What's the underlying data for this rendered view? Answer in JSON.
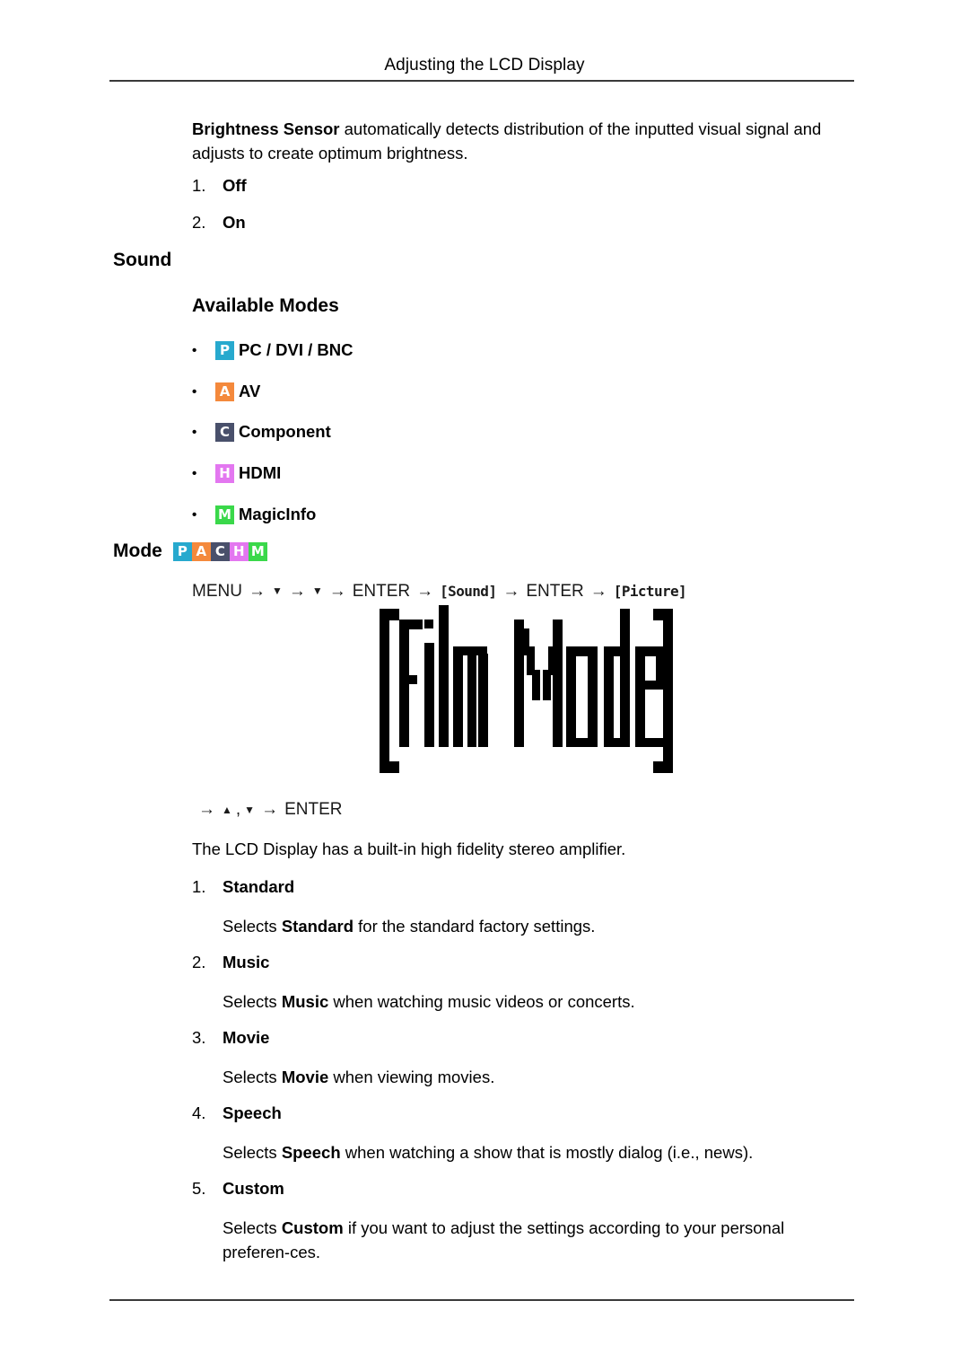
{
  "header": {
    "title": "Adjusting the LCD Display"
  },
  "intro": {
    "bold_lead": "Brightness Sensor",
    "rest": " automatically detects distribution of the inputted visual signal and adjusts to create optimum brightness."
  },
  "brightness_options": [
    {
      "num": "1.",
      "label": "Off"
    },
    {
      "num": "2.",
      "label": "On"
    }
  ],
  "sections": {
    "sound_heading": "Sound",
    "available_modes_heading": "Available Modes",
    "mode_heading": "Mode"
  },
  "available_modes": [
    {
      "bullet": "•",
      "badge": "P",
      "badge_color": "#27a9ce",
      "label": "PC / DVI / BNC"
    },
    {
      "bullet": "•",
      "badge": "A",
      "badge_color": "#f4893c",
      "label": "AV"
    },
    {
      "bullet": "•",
      "badge": "C",
      "badge_color": "#49506b",
      "label": "Component"
    },
    {
      "bullet": "•",
      "badge": "H",
      "badge_color": "#e377f0",
      "label": "HDMI"
    },
    {
      "bullet": "•",
      "badge": "M",
      "badge_color": "#3ad84a",
      "label": "MagicInfo"
    }
  ],
  "mode_badges": [
    {
      "badge": "P",
      "badge_color": "#27a9ce"
    },
    {
      "badge": "A",
      "badge_color": "#f4893c"
    },
    {
      "badge": "C",
      "badge_color": "#49506b"
    },
    {
      "badge": "H",
      "badge_color": "#e377f0"
    },
    {
      "badge": "M",
      "badge_color": "#3ad84a"
    }
  ],
  "nav_path": {
    "menu": "MENU",
    "arrow": "→",
    "down": "▼",
    "up": "▲",
    "enter": "ENTER",
    "osd_sound": "[Sound]",
    "osd_picture": "[Picture]"
  },
  "nav_path_2": {
    "arrow": "→",
    "up": "▲",
    "comma": ",",
    "down": "▼",
    "enter": "ENTER"
  },
  "film_mode_graphic": {
    "label": "[Film Mode]"
  },
  "amplifier_note": "The LCD Display has a built-in high fidelity stereo amplifier.",
  "sound_modes": [
    {
      "num": "1.",
      "label": "Standard",
      "desc_pre": "Selects ",
      "desc_bold": "Standard",
      "desc_post": " for the standard factory settings."
    },
    {
      "num": "2.",
      "label": "Music",
      "desc_pre": "Selects ",
      "desc_bold": "Music",
      "desc_post": " when watching music videos or concerts."
    },
    {
      "num": "3.",
      "label": "Movie",
      "desc_pre": "Selects ",
      "desc_bold": "Movie",
      "desc_post": " when viewing movies."
    },
    {
      "num": "4.",
      "label": "Speech",
      "desc_pre": "Selects ",
      "desc_bold": "Speech",
      "desc_post": " when watching a show that is mostly dialog (i.e., news)."
    },
    {
      "num": "5.",
      "label": "Custom",
      "desc_pre": "Selects ",
      "desc_bold": "Custom",
      "desc_post": " if you want to adjust the settings according to your personal preferen-ces."
    }
  ]
}
